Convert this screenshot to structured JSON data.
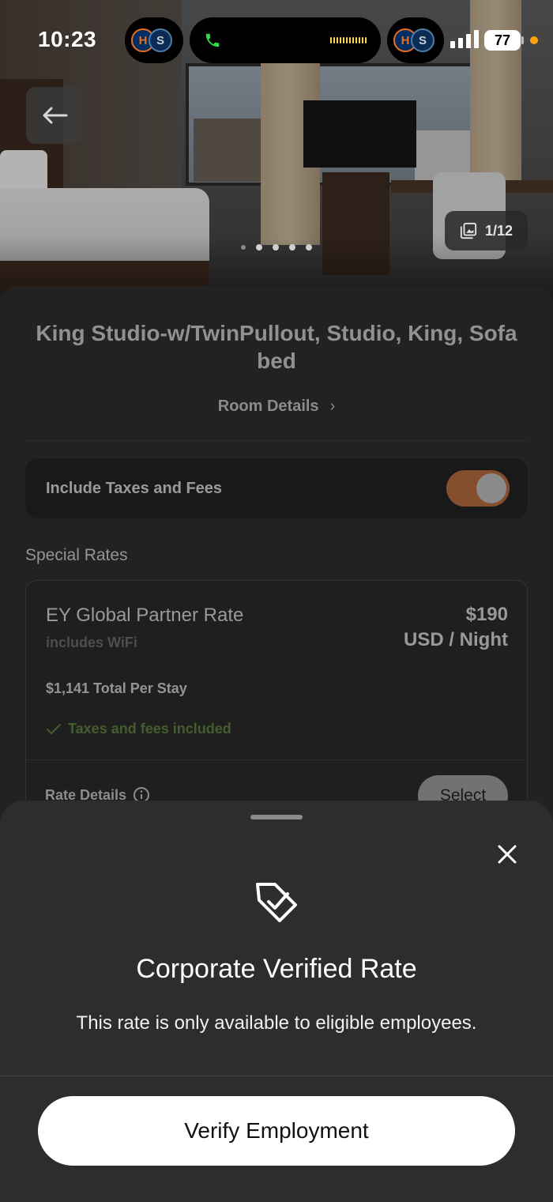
{
  "status_bar": {
    "time": "10:23",
    "battery": "77",
    "left_team_1": "H",
    "left_team_2": "S",
    "right_team_1": "H",
    "right_team_2": "S"
  },
  "gallery": {
    "counter": "1/12",
    "dot_count": 5
  },
  "room": {
    "title": "King Studio-w/TwinPullout, Studio, King, Sofa bed",
    "details_link": "Room Details",
    "details_chevron": "›"
  },
  "taxes": {
    "label": "Include Taxes and Fees",
    "enabled": true,
    "toggle_color": "#b36a40"
  },
  "special_rates": {
    "heading": "Special Rates",
    "rate": {
      "name": "EY Global Partner Rate",
      "includes": "includes WiFi",
      "price": "$190",
      "price_unit": "USD / Night",
      "total": "$1,141 Total Per Stay",
      "taxes_note": "Taxes and fees included",
      "details_label": "Rate Details",
      "select_label": "Select"
    }
  },
  "sheet": {
    "title": "Corporate Verified Rate",
    "description": "This rate is only available to eligible employees.",
    "button_label": "Verify Employment"
  },
  "colors": {
    "accent_green": "#5d7d3f",
    "sheet_bg": "#2d2d2d"
  }
}
